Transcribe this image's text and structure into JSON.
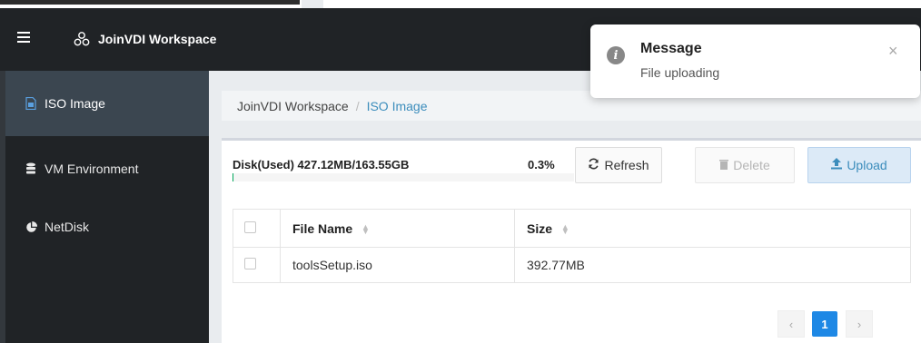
{
  "app": {
    "title": "JoinVDI Workspace"
  },
  "sidebar": {
    "items": [
      {
        "label": "ISO Image",
        "icon": "file-image-icon",
        "active": true
      },
      {
        "label": "VM Environment",
        "icon": "database-icon",
        "active": false
      },
      {
        "label": "NetDisk",
        "icon": "pie-chart-icon",
        "active": false
      }
    ]
  },
  "breadcrumb": {
    "root": "JoinVDI Workspace",
    "separator": "/",
    "current": "ISO Image"
  },
  "disk": {
    "label": "Disk(Used) 427.12MB/163.55GB",
    "percent_text": "0.3%",
    "percent_value": 0.3
  },
  "toolbar": {
    "refresh_label": "Refresh",
    "delete_label": "Delete",
    "upload_label": "Upload"
  },
  "table": {
    "headers": {
      "name": "File Name",
      "size": "Size"
    },
    "rows": [
      {
        "name": "toolsSetup.iso",
        "size": "392.77MB"
      }
    ]
  },
  "pagination": {
    "current": "1"
  },
  "toast": {
    "title": "Message",
    "text": "File uploading"
  },
  "colors": {
    "accent": "#3c8dbc",
    "sidebar_bg": "#202326",
    "progress": "#00a65a",
    "page_active": "#1e88e5"
  }
}
